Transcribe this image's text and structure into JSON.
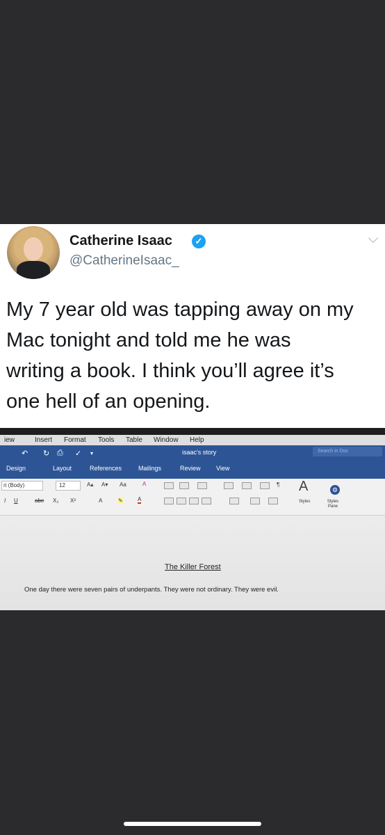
{
  "tweet": {
    "name": "Catherine Isaac",
    "handle": "@CatherineIsaac_",
    "lines": [
      "My 7 year old was tapping away on my",
      "Mac tonight and told me he was",
      "writing a book. I think you’ll agree it’s",
      "one hell of an opening."
    ]
  },
  "word": {
    "menubar": [
      "iew",
      "Insert",
      "Format",
      "Tools",
      "Table",
      "Window",
      "Help"
    ],
    "doc_name": "isaac's story",
    "search_placeholder": "Search in Doc",
    "ribbon_tabs": [
      "Design",
      "Layout",
      "References",
      "Mailings",
      "Review",
      "View"
    ],
    "font_name": "ri (Body)",
    "font_size": "12",
    "format_buttons": [
      "I",
      "U",
      "abe",
      "X₂",
      "X²"
    ],
    "styles_label": "Styles",
    "styles_pane_label": "Styles Pane",
    "document": {
      "title": "The Killer Forest",
      "text": "One day there were seven pairs of underpants. They were not ordinary. They were evil."
    }
  },
  "colors": {
    "verified": "#1da1f2",
    "ribbon": "#2d5596",
    "background": "#2b2b2d"
  }
}
